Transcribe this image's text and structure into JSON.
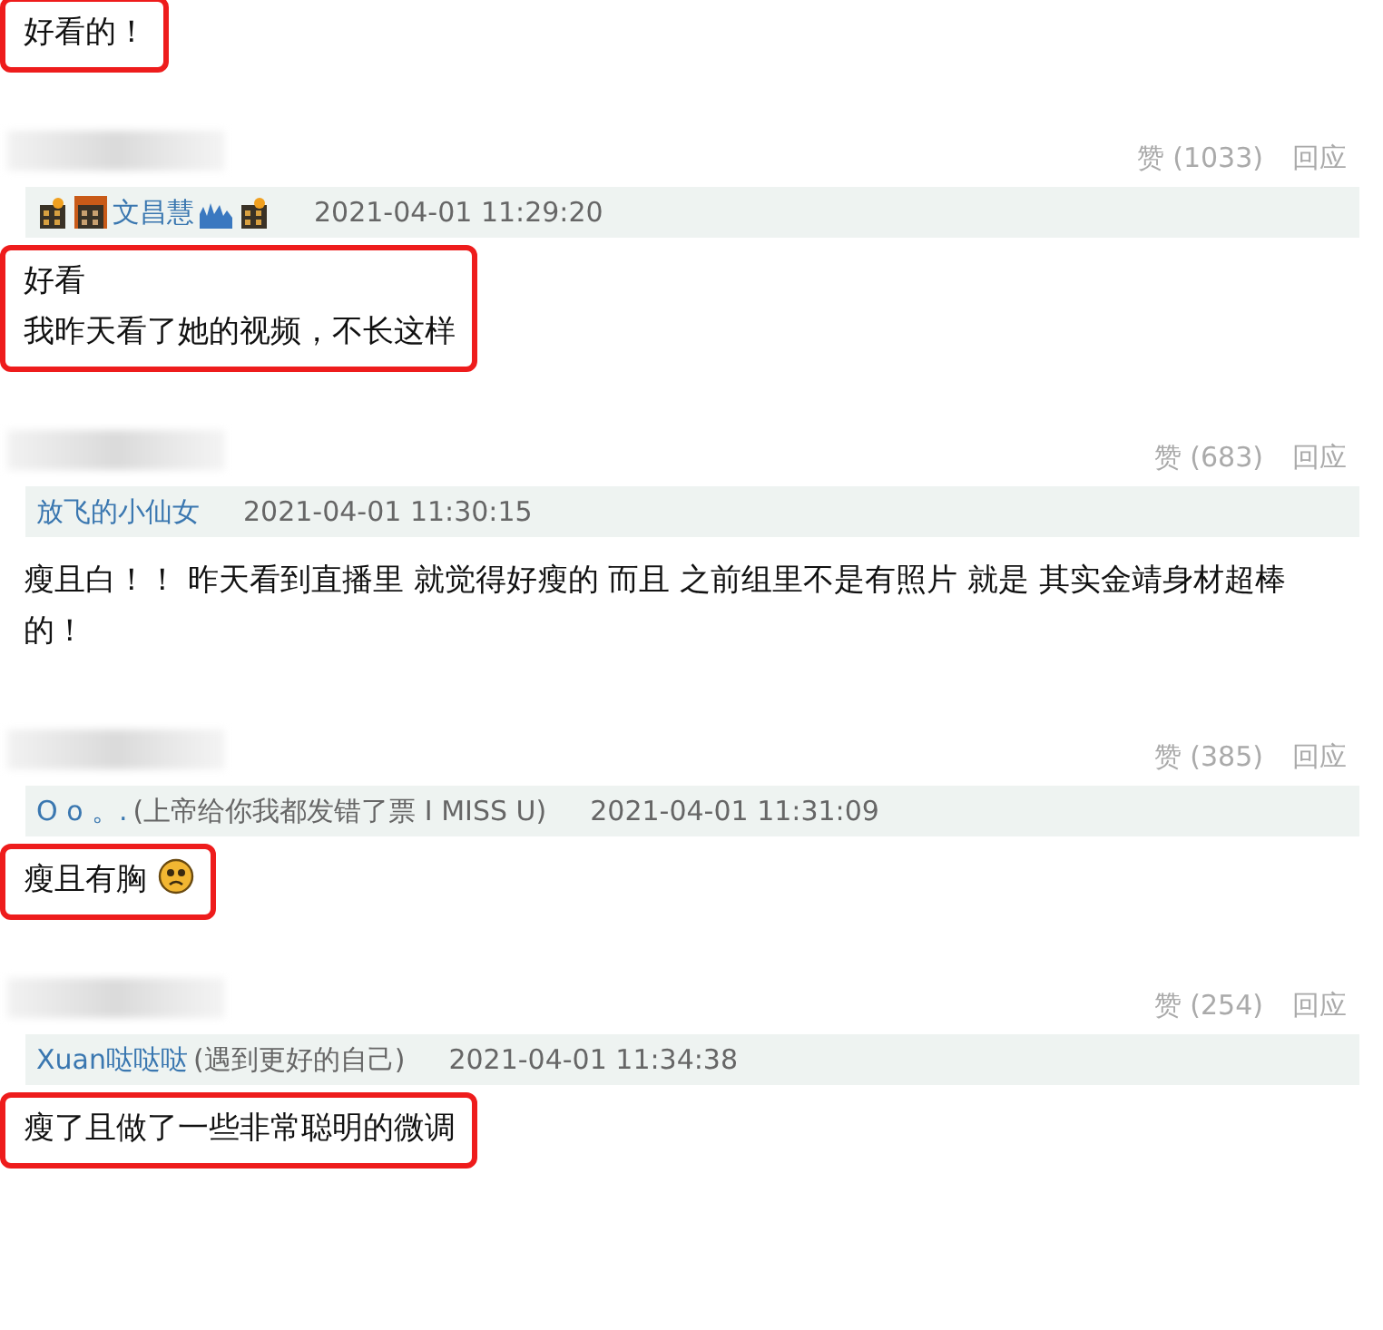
{
  "top_reply": {
    "lines": [
      [
        {
          "kind": "text",
          "text": "好看的！"
        }
      ]
    ],
    "highlighted": true
  },
  "comments": [
    {
      "votes": "赞 (1033)",
      "reply": "回应",
      "author": [
        {
          "kind": "tower"
        },
        {
          "kind": "blocks"
        },
        {
          "kind": "name",
          "text": "文昌慧"
        },
        {
          "kind": "skyline"
        },
        {
          "kind": "tower"
        }
      ],
      "time": "2021-04-01 11:29:20",
      "body": {
        "lines": [
          [
            {
              "kind": "text",
              "text": "好看"
            }
          ],
          [
            {
              "kind": "text",
              "text": "我昨天看了她的视频，不长这样"
            }
          ]
        ],
        "highlighted": true
      }
    },
    {
      "votes": "赞 (683)",
      "reply": "回应",
      "author": [
        {
          "kind": "name",
          "text": "放飞的小仙女"
        }
      ],
      "time": "2021-04-01 11:30:15",
      "body": {
        "lines": [
          [
            {
              "kind": "text",
              "text": "瘦且白！！ 昨天看到直播里 就觉得好瘦的 而且 之前组里不是有照片 就是 其实金靖身材超棒的！"
            }
          ]
        ],
        "highlighted": false
      }
    },
    {
      "votes": "赞 (385)",
      "reply": "回应",
      "author": [
        {
          "kind": "name",
          "text": "O o 。."
        },
        {
          "kind": "note",
          "text": "(上帝给你我都发错了票 I MISS U)"
        }
      ],
      "time": "2021-04-01 11:31:09",
      "body": {
        "lines": [
          [
            {
              "kind": "text",
              "text": "瘦且有胸"
            },
            {
              "kind": "frown"
            }
          ]
        ],
        "highlighted": true
      }
    },
    {
      "votes": "赞 (254)",
      "reply": "回应",
      "author": [
        {
          "kind": "name",
          "text": "Xuan哒哒哒"
        },
        {
          "kind": "note",
          "text": "(遇到更好的自己)"
        }
      ],
      "time": "2021-04-01 11:34:38",
      "body": {
        "lines": [
          [
            {
              "kind": "text",
              "text": "瘦了且做了一些非常聪明的微调"
            }
          ]
        ],
        "highlighted": true
      }
    }
  ]
}
